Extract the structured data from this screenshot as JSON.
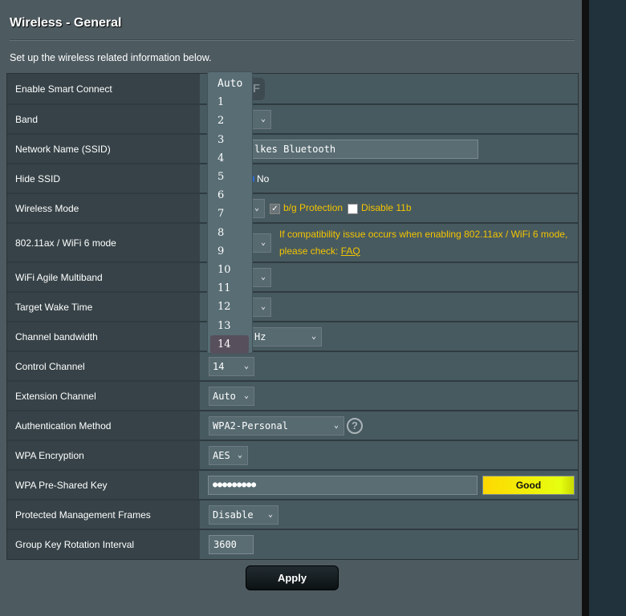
{
  "title": "Wireless - General",
  "description": "Set up the wireless related information below.",
  "rows": [
    {
      "label": "Enable Smart Connect",
      "toggle_visible": "F"
    },
    {
      "label": "Band"
    },
    {
      "label": "Network Name (SSID)",
      "value_visible": "lkes Bluetooth"
    },
    {
      "label": "Hide SSID",
      "radio_no": "No"
    },
    {
      "label": "Wireless Mode",
      "bg_protection": "b/g Protection",
      "disable_11b": "Disable 11b"
    },
    {
      "label": "802.11ax / WiFi 6 mode",
      "notice": "If compatibility issue occurs when enabling 802.11ax / WiFi 6 mode,",
      "notice2": "please check:",
      "faq": "FAQ"
    },
    {
      "label": "WiFi Agile Multiband"
    },
    {
      "label": "Target Wake Time"
    },
    {
      "label": "Channel bandwidth",
      "value_visible": "Hz"
    },
    {
      "label": "Control Channel",
      "value": "14"
    },
    {
      "label": "Extension Channel",
      "value": "Auto"
    },
    {
      "label": "Authentication Method",
      "value": "WPA2-Personal"
    },
    {
      "label": "WPA Encryption",
      "value": "AES"
    },
    {
      "label": "WPA Pre-Shared Key",
      "value": "●●●●●●●●●",
      "strength": "Good"
    },
    {
      "label": "Protected Management Frames",
      "value": "Disable"
    },
    {
      "label": "Group Key Rotation Interval",
      "value": "3600"
    }
  ],
  "channel_dropdown": {
    "options": [
      "Auto",
      "1",
      "2",
      "3",
      "4",
      "5",
      "6",
      "7",
      "8",
      "9",
      "10",
      "11",
      "12",
      "13",
      "14"
    ],
    "highlighted": "14"
  },
  "apply_label": "Apply",
  "colors": {
    "notice": "#f4c400",
    "strength_good": "#ffd800"
  }
}
